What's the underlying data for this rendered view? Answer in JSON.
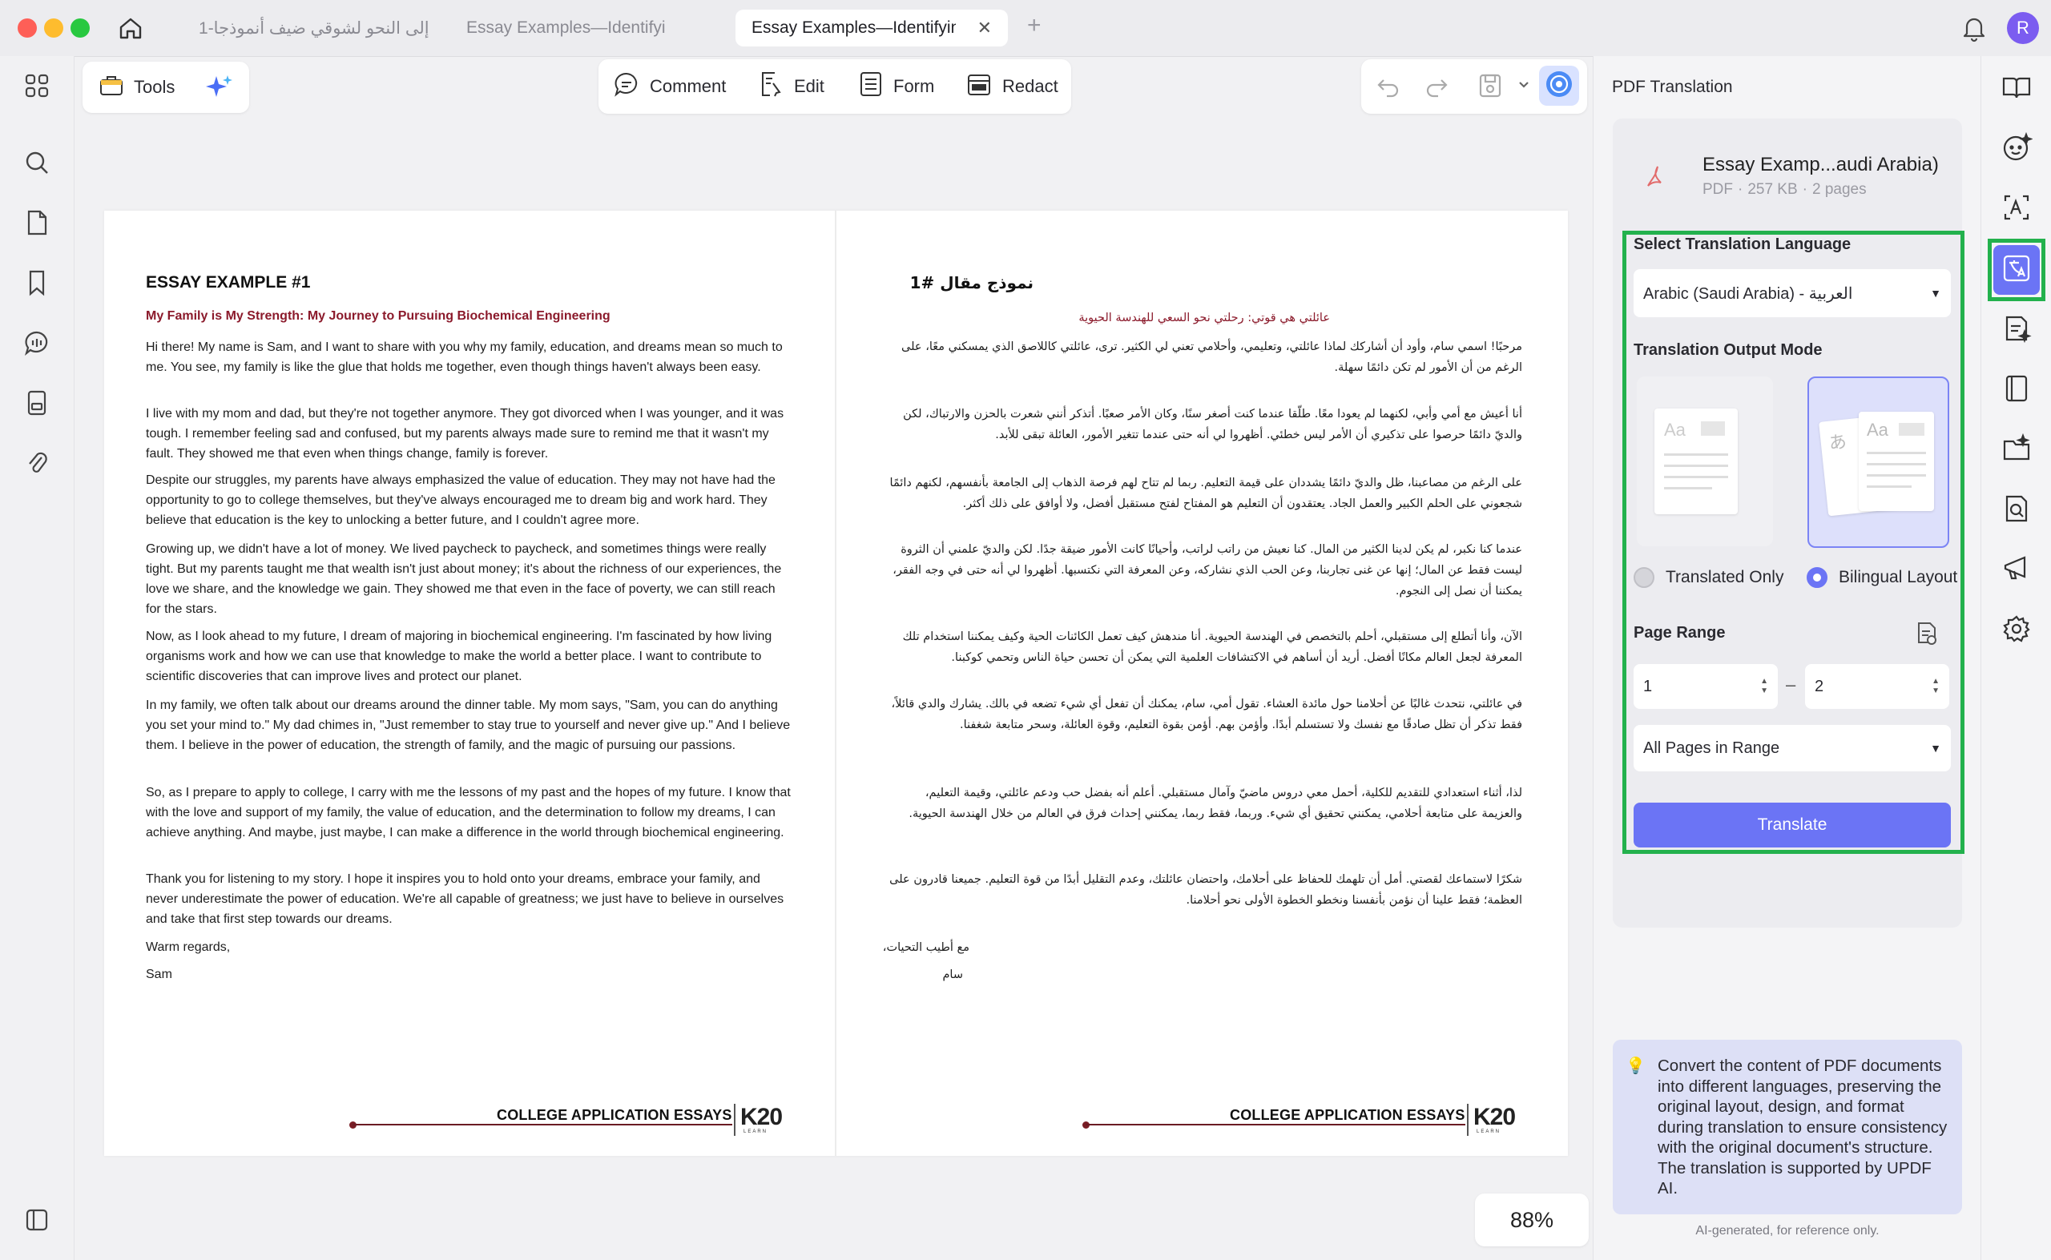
{
  "tabs": [
    {
      "label": "إلى النحو لشوقي ضيف أنموذجا-1"
    },
    {
      "label": "Essay Examples—Identifyi"
    },
    {
      "label": "Essay Examples—Identifyin"
    }
  ],
  "avatar_initial": "R",
  "toolbar": {
    "tools_label": "Tools",
    "comment_label": "Comment",
    "edit_label": "Edit",
    "form_label": "Form",
    "redact_label": "Redact"
  },
  "zoom": "88%",
  "document": {
    "english": {
      "heading": "ESSAY EXAMPLE #1",
      "subtitle": "My Family is My Strength: My Journey to Pursuing Biochemical Engineering",
      "paragraphs": [
        "Hi there! My name is Sam, and I want to share with you why my family, education, and dreams mean so much to me. You see, my family is like the glue that holds me together, even though things haven't always been easy.",
        "I live with my mom and dad, but they're not together anymore. They got divorced when I was younger, and it was tough. I remember feeling sad and confused, but my parents always made sure to remind me that it wasn't my fault. They showed me that even when things change, family is forever.",
        "Despite our struggles, my parents have always emphasized the value of education. They may not have had the opportunity to go to college themselves, but they've always encouraged me to dream big and work hard. They believe that education is the key to unlocking a better future, and I couldn't agree more.",
        "Growing up, we didn't have a lot of money. We lived paycheck to paycheck, and sometimes things were really tight. But my parents taught me that wealth isn't just about money; it's about the richness of our experiences, the love we share, and the knowledge we gain. They showed me that even in the face of poverty, we can still reach for the stars.",
        "Now, as I look ahead to my future, I dream of majoring in biochemical engineering. I'm fascinated by how living organisms work and how we can use that knowledge to make the world a better place. I want to contribute to scientific discoveries that can improve lives and protect our planet.",
        "In my family, we often talk about our dreams around the dinner table. My mom says, \"Sam, you can do anything you set your mind to.\" My dad chimes in, \"Just remember to stay true to yourself and never give up.\" And I believe them. I believe in the power of education, the strength of family, and the magic of pursuing our passions.",
        "So, as I prepare to apply to college, I carry with me the lessons of my past and the hopes of my future. I know that with the love and support of my family, the value of education, and the determination to follow my dreams, I can achieve anything. And maybe, just maybe, I can make a difference in the world through biochemical engineering.",
        "Thank you for listening to my story. I hope it inspires you to hold onto your dreams, embrace your family, and never underestimate the power of education. We're all capable of greatness; we just have to believe in ourselves and take that first step towards our dreams."
      ],
      "closing": "Warm regards,",
      "signature": "Sam"
    },
    "arabic": {
      "heading": "نموذج مقال #1",
      "subtitle": "عائلتي هي قوتي: رحلتي نحو السعي للهندسة الحيوية",
      "paragraphs": [
        "مرحبًا! اسمي سام، وأود أن أشاركك لماذا عائلتي، وتعليمي، وأحلامي تعني لي الكثير. ترى، عائلتي كاللاصق الذي يمسكني معًا، على الرغم من أن الأمور لم تكن دائمًا سهلة.",
        "أنا أعيش مع أمي وأبي، لكنهما لم يعودا معًا. طلّقا عندما كنت أصغر سنًا، وكان الأمر صعبًا. أتذكر أنني شعرت بالحزن والارتباك، لكن والديّ دائمًا حرصوا على تذكيري أن الأمر ليس خطئي. أظهروا لي أنه حتى عندما تتغير الأمور، العائلة تبقى للأبد.",
        "على الرغم من مصاعبنا، ظل والديّ دائمًا يشددان على قيمة التعليم. ربما لم تتاح لهم فرصة الذهاب إلى الجامعة بأنفسهم، لكنهم دائمًا شجعوني على الحلم الكبير والعمل الجاد. يعتقدون أن التعليم هو المفتاح لفتح مستقبل أفضل، ولا أوافق على ذلك أكثر.",
        "عندما كنا نكبر، لم يكن لدينا الكثير من المال. كنا نعيش من راتب لراتب، وأحيانًا كانت الأمور ضيقة جدًا. لكن والديّ علمني أن الثروة ليست فقط عن المال؛ إنها عن غنى تجاربنا، وعن الحب الذي نشاركه، وعن المعرفة التي نكتسبها. أظهروا لي أنه حتى في وجه الفقر، يمكننا أن نصل إلى النجوم.",
        "الآن، وأنا أتطلع إلى مستقبلي، أحلم بالتخصص في الهندسة الحيوية. أنا مندهش كيف تعمل الكائنات الحية وكيف يمكننا استخدام تلك المعرفة لجعل العالم مكانًا أفضل. أريد أن أساهم في الاكتشافات العلمية التي يمكن أن تحسن حياة الناس وتحمي كوكبنا.",
        "في عائلتي، نتحدث غالبًا عن أحلامنا حول مائدة العشاء. تقول أمي، سام، يمكنك أن تفعل أي شيء تضعه في بالك. يشارك والدي قائلاً، فقط تذكر أن تظل صادقًا مع نفسك ولا تستسلم أبدًا. وأؤمن بهم. أؤمن بقوة التعليم، وقوة العائلة، وسحر متابعة شغفنا.",
        "لذا، أثناء استعدادي للتقديم للكلية، أحمل معي دروس ماضيّ وآمال مستقبلي. أعلم أنه بفضل حب ودعم عائلتي، وقيمة التعليم، والعزيمة على متابعة أحلامي، يمكنني تحقيق أي شيء. وربما، فقط ربما، يمكنني إحداث فرق في العالم من خلال الهندسة الحيوية.",
        "شكرًا لاستماعك لقصتي. أمل أن تلهمك للحفاظ على أحلامك، واحتضان عائلتك، وعدم التقليل أبدًا من قوة التعليم. جميعنا قادرون على العظمة؛ فقط علينا أن نؤمن بأنفسنا ونخطو الخطوة الأولى نحو أحلامنا."
      ],
      "closing": "مع أطيب التحيات،",
      "signature": "سام"
    },
    "footer_text": "COLLEGE APPLICATION ESSAYS",
    "footer_logo": "K20",
    "footer_logo_sub": "LEARN"
  },
  "panel": {
    "title": "PDF Translation",
    "file_name": "Essay Examp...audi Arabia)",
    "file_type": "PDF",
    "file_size": "257 KB",
    "file_pages": "2 pages",
    "lang_label": "Select Translation Language",
    "lang_value": "Arabic (Saudi Arabia) - العربية",
    "mode_label": "Translation Output Mode",
    "mode_translated": "Translated Only",
    "mode_bilingual": "Bilingual Layout",
    "page_range_label": "Page Range",
    "range_from": "1",
    "range_to": "2",
    "range_dash": "–",
    "pages_option": "All Pages in Range",
    "translate_button": "Translate",
    "info_text": "Convert the content of PDF documents into different languages, preserving the original layout, design, and format during translation to ensure consistency with the original document's structure. The translation is supported by UPDF AI.",
    "disclaimer": "AI-generated, for reference only."
  },
  "colors": {
    "accent": "#6b74f5",
    "highlight_green": "#23b14d",
    "subtitle_red": "#8b1a2b"
  }
}
